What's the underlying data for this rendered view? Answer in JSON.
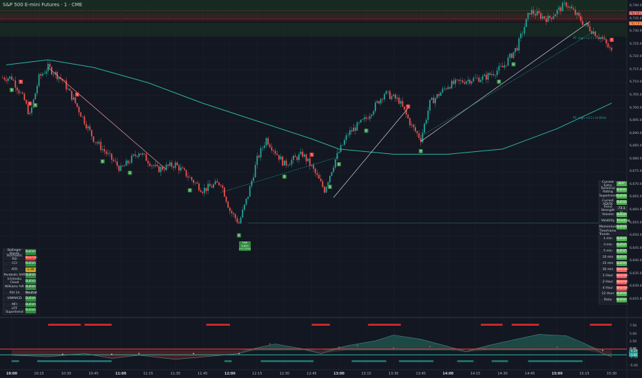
{
  "title": "S&P 500 E-mini Futures · 1 · CME",
  "colors": {
    "bg": "#131722",
    "up": "#26a69a",
    "down": "#ef5350",
    "bullish": "#2e8b3e",
    "bearish": "#d83b3b",
    "ma": "#2bb5a6"
  },
  "price_axis": {
    "ticks": [
      "6,740.00",
      "6,735.00",
      "6,730.00",
      "6,725.00",
      "6,720.00",
      "6,715.00",
      "6,710.00",
      "6,705.00",
      "6,700.00",
      "6,695.00",
      "6,690.00",
      "6,685.00",
      "6,680.00",
      "6,675.00",
      "6,670.00",
      "6,665.00",
      "6,660.00",
      "6,655.00",
      "6,650.00",
      "6,645.00",
      "6,640.00",
      "6,635.00",
      "6,630.00",
      "6,625.00"
    ],
    "marker_labels": [
      "6,737.25",
      "6,733.25"
    ]
  },
  "osc_axis": {
    "ticks": [
      "7.50",
      "5.00",
      "2.50",
      "0.00",
      "-2.50",
      "-5.00"
    ],
    "marker_labels": [
      "0.40",
      "-0.19",
      "-1.41"
    ]
  },
  "time_axis": {
    "labels": [
      "10:00",
      "10:15",
      "10:30",
      "10:45",
      "11:00",
      "11:15",
      "11:30",
      "11:45",
      "12:00",
      "12:15",
      "12:30",
      "12:45",
      "13:00",
      "13:15",
      "13:30",
      "13:45",
      "14:00",
      "14:15",
      "14:30",
      "14:45",
      "15:00",
      "15:15",
      "15:30"
    ]
  },
  "trend_notes": [
    "PT: align +4.7 (+0.07%)",
    "PT: align +4.5 (+0.06%)"
  ],
  "low_marker": {
    "line1": "Low 6,653",
    "line2": "(+0.12%)"
  },
  "indicator_table": {
    "rows": [
      {
        "label": "Bollinger Bands",
        "value": "Bullish",
        "status": "bull"
      },
      {
        "label": "Stochastic RSI",
        "value": "Bearish",
        "status": "bear"
      },
      {
        "label": "CCI",
        "value": "Bullish",
        "status": "bull"
      },
      {
        "label": "ATR",
        "value": "1.38",
        "status": "warn"
      },
      {
        "label": "Parabolic SAR",
        "value": "Bullish",
        "status": "bull"
      },
      {
        "label": "Ichimoku Cloud",
        "value": "Bullish",
        "status": "bull"
      },
      {
        "label": "Williams %R",
        "value": "Bullish",
        "status": "bull"
      },
      {
        "label": "RSI 14",
        "value": "Neutral",
        "status": "neut"
      },
      {
        "label": "VWMACD",
        "value": "Bullish",
        "status": "bull"
      },
      {
        "label": "MFI",
        "value": "Bullish",
        "status": "bull"
      },
      {
        "label": "HTF Supertrend",
        "value": "Bullish",
        "status": "bull"
      }
    ]
  },
  "summary_table": {
    "rows": [
      {
        "label": "Current Entry",
        "value": "BUY",
        "status": "bull2"
      },
      {
        "label": "Technical Rating",
        "value": "Bullish",
        "status": "bull2"
      },
      {
        "label": "Supertrend",
        "value": "Bullish",
        "status": "bull2"
      },
      {
        "label": "Current ADI/DI",
        "value": "Bullish",
        "status": "bull2"
      },
      {
        "label": "Trend Strength",
        "value": "73.1 %",
        "status": "neut"
      },
      {
        "label": "Volume",
        "value": "Bullish",
        "status": "bull2"
      },
      {
        "label": "Volatility",
        "value": "Trending",
        "status": "bull2"
      },
      {
        "label": "Momentum",
        "value": "Bullish",
        "status": "bull2"
      }
    ],
    "timeframe_header": "Timeframe Trends",
    "timeframes": [
      {
        "label": "1 min",
        "value": "Bullish",
        "status": "bull2"
      },
      {
        "label": "3 min",
        "value": "Bullish",
        "status": "bull2"
      },
      {
        "label": "5 min",
        "value": "Bullish",
        "status": "bull2"
      },
      {
        "label": "10 min",
        "value": "Bullish",
        "status": "bull2"
      },
      {
        "label": "15 min",
        "value": "Bullish",
        "status": "bull2"
      },
      {
        "label": "30 min",
        "value": "Bearish",
        "status": "bear2"
      },
      {
        "label": "1 Hour",
        "value": "Bearish",
        "status": "bear2"
      },
      {
        "label": "2 Hour",
        "value": "Bearish",
        "status": "bear2"
      },
      {
        "label": "4 Hour",
        "value": "Bearish",
        "status": "bear2"
      },
      {
        "label": "12 Hour",
        "value": "Bullish",
        "status": "bull2"
      },
      {
        "label": "Daily",
        "value": "Bullish",
        "status": "bull2"
      }
    ]
  },
  "signals": [
    {
      "type": "B",
      "t": "10:00"
    },
    {
      "type": "S",
      "t": "10:05"
    },
    {
      "type": "S",
      "t": "10:10"
    },
    {
      "type": "B",
      "t": "10:13"
    },
    {
      "type": "S",
      "t": "10:36"
    },
    {
      "type": "B",
      "t": "10:50"
    },
    {
      "type": "B",
      "t": "11:05"
    },
    {
      "type": "B",
      "t": "11:38"
    },
    {
      "type": "B",
      "t": "12:05"
    },
    {
      "type": "B",
      "t": "12:30"
    },
    {
      "type": "S",
      "t": "12:45"
    },
    {
      "type": "B",
      "t": "12:55"
    },
    {
      "type": "B",
      "t": "13:00"
    },
    {
      "type": "B",
      "t": "13:15"
    },
    {
      "type": "S",
      "t": "13:38"
    },
    {
      "type": "B",
      "t": "13:45"
    },
    {
      "type": "B",
      "t": "14:28"
    },
    {
      "type": "B",
      "t": "14:36"
    },
    {
      "type": "S",
      "t": "15:05"
    },
    {
      "type": "S",
      "t": "15:30"
    }
  ]
}
